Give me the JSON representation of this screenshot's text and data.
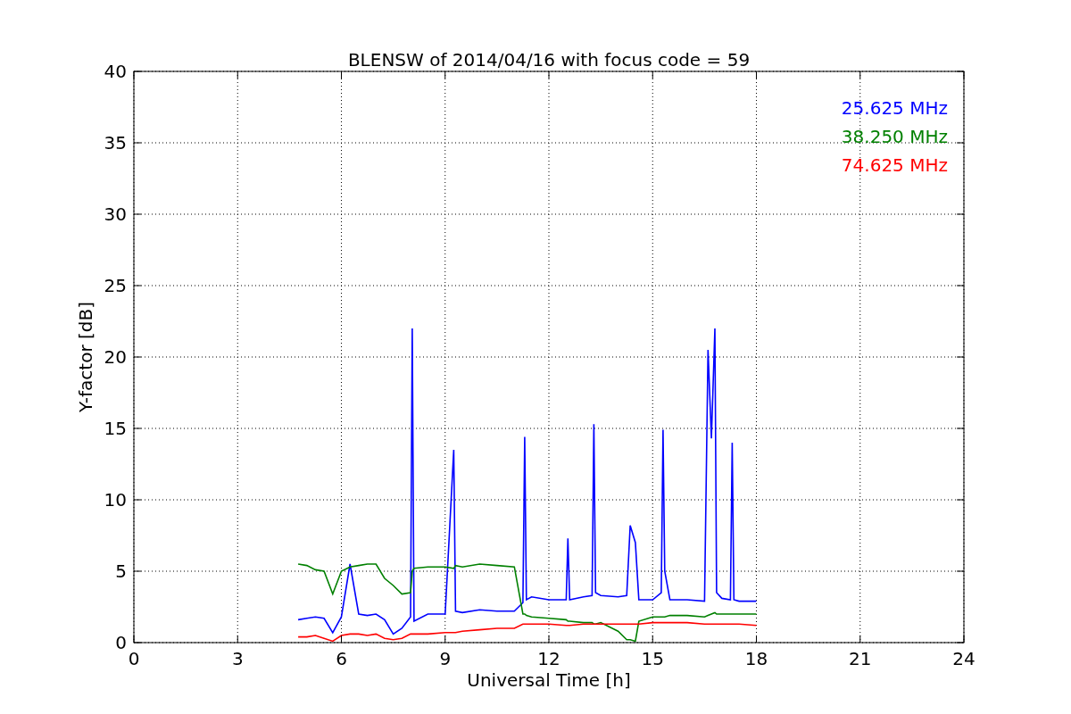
{
  "figure": {
    "chart_data": {
      "type": "line",
      "title": "BLENSW of 2014/04/16 with focus code = 59",
      "xlabel": "Universal Time [h]",
      "ylabel": "Y-factor [dB]",
      "x": [
        4.75,
        5,
        5.25,
        5.5,
        5.75,
        6,
        6.25,
        6.5,
        6.75,
        7,
        7.25,
        7.5,
        7.75,
        8,
        8.05,
        8.1,
        8.5,
        9,
        9.25,
        9.3,
        9.5,
        10,
        10.5,
        11,
        11.25,
        11.3,
        11.35,
        11.5,
        12,
        12.5,
        12.55,
        12.6,
        13,
        13.25,
        13.3,
        13.35,
        13.5,
        14,
        14.25,
        14.35,
        14.5,
        14.6,
        15,
        15.25,
        15.3,
        15.35,
        15.5,
        16,
        16.5,
        16.6,
        16.7,
        16.8,
        16.85,
        17,
        17.25,
        17.3,
        17.35,
        17.5,
        18
      ],
      "series": [
        {
          "name": "25.625 MHz",
          "color": "#0000ff",
          "values": [
            1.6,
            1.7,
            1.8,
            1.7,
            0.7,
            1.8,
            5.5,
            2.0,
            1.9,
            2.0,
            1.6,
            0.6,
            1.0,
            1.8,
            22,
            1.5,
            2.0,
            2.0,
            13.5,
            2.2,
            2.1,
            2.3,
            2.2,
            2.2,
            2.8,
            14.4,
            3.0,
            3.2,
            3.0,
            3.0,
            7.3,
            3.0,
            3.2,
            3.3,
            15.3,
            3.5,
            3.3,
            3.2,
            3.3,
            8.2,
            7.0,
            3.0,
            3.0,
            3.5,
            14.9,
            5.0,
            3.0,
            3.0,
            2.9,
            20.5,
            14.3,
            22,
            3.5,
            3.1,
            3.0,
            14,
            3.0,
            2.9,
            2.9
          ]
        },
        {
          "name": "38.250 MHz",
          "color": "#008000",
          "values": [
            5.5,
            5.4,
            5.1,
            5.0,
            3.4,
            5.0,
            5.3,
            5.4,
            5.5,
            5.5,
            4.5,
            4.0,
            3.4,
            3.5,
            5.0,
            5.2,
            5.3,
            5.3,
            5.2,
            5.4,
            5.3,
            5.5,
            5.4,
            5.3,
            2.0,
            2.0,
            1.9,
            1.8,
            1.7,
            1.6,
            1.5,
            1.5,
            1.4,
            1.4,
            1.3,
            1.3,
            1.4,
            0.8,
            0.2,
            0.2,
            0.1,
            1.5,
            1.8,
            1.8,
            1.8,
            1.8,
            1.9,
            1.9,
            1.8,
            1.9,
            2.0,
            2.1,
            2.0,
            2.0,
            2.0,
            2.0,
            2.0,
            2.0,
            2.0
          ]
        },
        {
          "name": "74.625 MHz",
          "color": "#ff0000",
          "values": [
            0.4,
            0.4,
            0.5,
            0.3,
            0.1,
            0.5,
            0.6,
            0.6,
            0.5,
            0.6,
            0.3,
            0.2,
            0.3,
            0.6,
            0.6,
            0.6,
            0.6,
            0.7,
            0.7,
            0.7,
            0.8,
            0.9,
            1.0,
            1.0,
            1.3,
            1.3,
            1.3,
            1.3,
            1.3,
            1.2,
            1.2,
            1.2,
            1.3,
            1.3,
            1.3,
            1.3,
            1.3,
            1.3,
            1.3,
            1.3,
            1.3,
            1.3,
            1.4,
            1.4,
            1.4,
            1.4,
            1.4,
            1.4,
            1.3,
            1.3,
            1.3,
            1.3,
            1.3,
            1.3,
            1.3,
            1.3,
            1.3,
            1.3,
            1.2
          ]
        }
      ],
      "xlim": [
        0,
        24
      ],
      "ylim": [
        0,
        40
      ],
      "xticks": [
        0,
        3,
        6,
        9,
        12,
        15,
        18,
        21,
        24
      ],
      "yticks": [
        0,
        5,
        10,
        15,
        20,
        25,
        30,
        35,
        40
      ],
      "grid": true
    }
  }
}
